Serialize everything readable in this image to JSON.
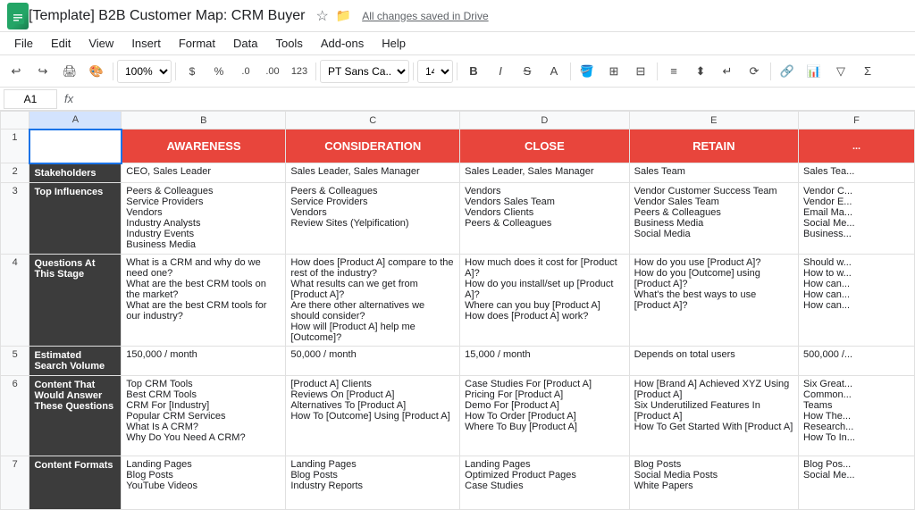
{
  "titleBar": {
    "docTitle": "[Template] B2B Customer Map: CRM Buyer",
    "autosave": "All changes saved in Drive",
    "starIcon": "★",
    "folderIcon": "🗁"
  },
  "menuBar": {
    "items": [
      "File",
      "Edit",
      "View",
      "Insert",
      "Format",
      "Data",
      "Tools",
      "Add-ons",
      "Help"
    ]
  },
  "toolbar": {
    "zoom": "100%",
    "font": "PT Sans Ca...",
    "fontSize": "14"
  },
  "formulaBar": {
    "cellRef": "A1",
    "fxLabel": "fx"
  },
  "sheet": {
    "columnHeaders": [
      "",
      "A",
      "B",
      "C",
      "D",
      "E",
      "F"
    ],
    "phases": {
      "b": "AWARENESS",
      "c": "CONSIDERATION",
      "d": "CLOSE",
      "e": "RETAIN",
      "f": "..."
    },
    "rows": [
      {
        "rowNum": "2",
        "label": "Stakeholders",
        "b": "CEO, Sales Leader",
        "c": "Sales Leader, Sales Manager",
        "d": "Sales Leader, Sales Manager",
        "e": "Sales Team",
        "f": "Sales Tea..."
      },
      {
        "rowNum": "3",
        "label": "Top Influences",
        "b": "Peers & Colleagues\nService Providers\nVendors\nIndustry Analysts\nIndustry Events\nBusiness Media",
        "c": "Peers & Colleagues\nService Providers\nVendors\nReview Sites (Yelpification)",
        "d": "Vendors\nVendors Sales Team\nVendors Clients\nPeers & Colleagues",
        "e": "Vendor Customer Success Team\nVendor Sales Team\nPeers & Colleagues\nBusiness Media\nSocial Media",
        "f": "Vendor C...\nVendor E...\nEmail Ma...\nSocial Me...\nBusiness..."
      },
      {
        "rowNum": "4",
        "label": "Questions At This Stage",
        "b": "What is a CRM and why do we need one?\nWhat are the best CRM tools on the market?\nWhat are the best CRM tools for our industry?",
        "c": "How does [Product A] compare to the rest of the industry?\nWhat results can we get from [Product A]?\nAre there other alternatives we should consider?\nHow will [Product A] help me [Outcome]?",
        "d": "How much does it cost for [Product A]?\nHow do you install/set up [Product A]?\nWhere can you buy [Product A]\nHow does [Product A] work?",
        "e": "How do you use [Product A]?\nHow do you [Outcome] using [Product A]?\nWhat's the best ways to use [Product A]?",
        "f": "Should w...\nHow to w...\nHow can...\nHow can...\nHow can..."
      },
      {
        "rowNum": "5",
        "label": "Estimated Search Volume",
        "b": "150,000 / month",
        "c": "50,000 / month",
        "d": "15,000 / month",
        "e": "Depends on total users",
        "f": "500,000 /..."
      },
      {
        "rowNum": "6",
        "label": "Content That Would Answer These Questions",
        "b": "Top CRM Tools\nBest CRM Tools\nCRM For [Industry]\nPopular CRM Services\nWhat Is A CRM?\nWhy Do You Need A CRM?",
        "c": "[Product A] Clients\nReviews On [Product A]\nAlternatives To [Product A]\nHow To [Outcome] Using [Product A]",
        "d": "Case Studies For [Product A]\nPricing For [Product A]\nDemo For [Product A]\nHow To Order [Product A]\nWhere To Buy [Product A]",
        "e": "How [Brand A] Achieved XYZ Using [Product A]\nSix Underutilized Features In [Product A]\nHow To Get Started With [Product A]",
        "f": "Six Great...\nCommon...\nTeams\nHow The...\nResearch...\nHow To In..."
      },
      {
        "rowNum": "7",
        "label": "Content Formats",
        "b": "Landing Pages\nBlog Posts\nYouTube Videos",
        "c": "Landing Pages\nBlog Posts\nIndustry Reports",
        "d": "Landing Pages\nOptimized Product Pages\nCase Studies",
        "e": "Blog Posts\nSocial Media Posts\nWhite Papers",
        "f": "Blog Pos...\nSocial Me..."
      }
    ]
  }
}
